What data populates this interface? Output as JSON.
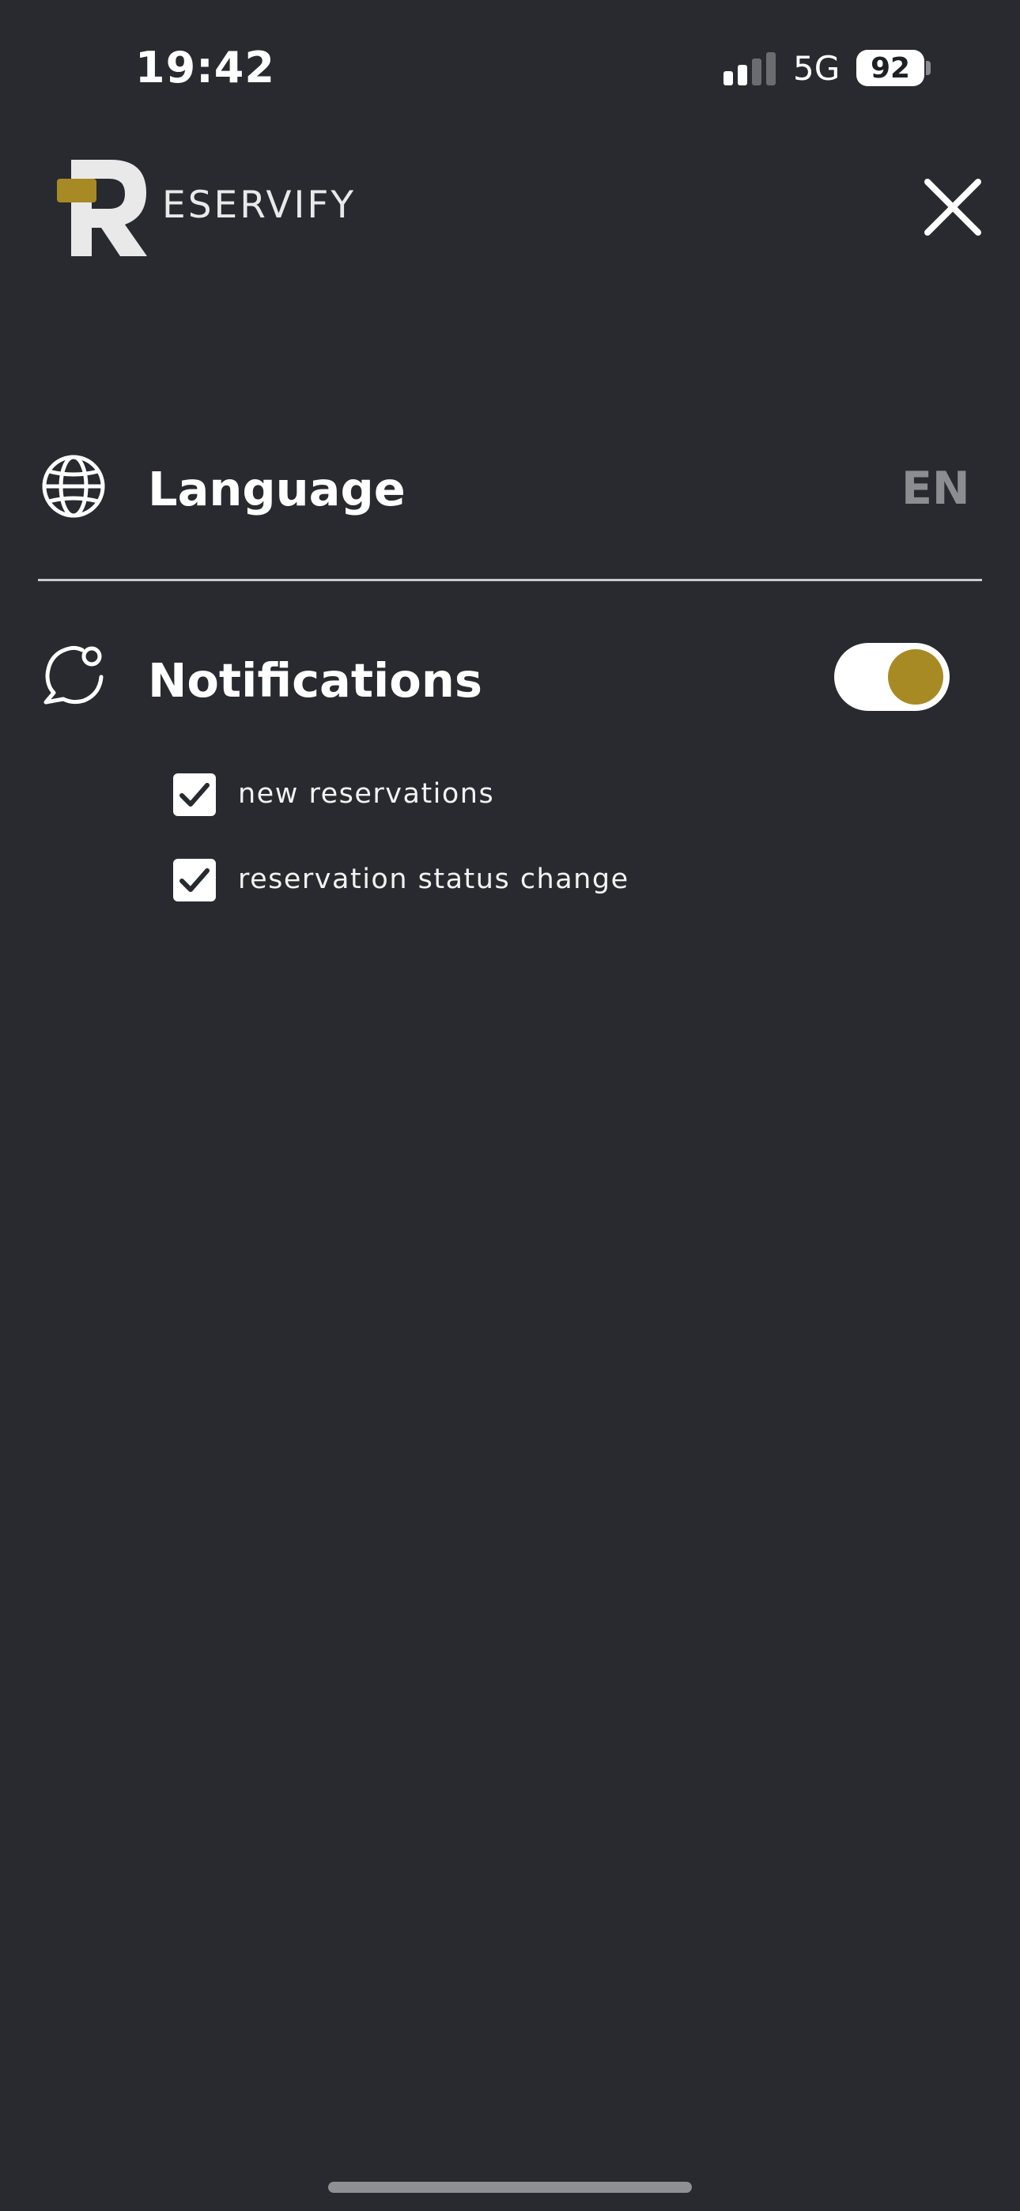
{
  "status_bar": {
    "time": "19:42",
    "network": "5G",
    "battery": "92"
  },
  "header": {
    "brand_text": "ESERVIFY"
  },
  "settings": {
    "language": {
      "label": "Language",
      "value": "EN"
    },
    "notifications": {
      "label": "Notifications",
      "enabled": true,
      "options": [
        {
          "label": "new reservations",
          "checked": true
        },
        {
          "label": "reservation status change",
          "checked": true
        }
      ]
    }
  },
  "colors": {
    "background": "#282a2f",
    "accent": "#a88a24",
    "muted_text": "#8b8d91"
  },
  "icons": {
    "language": "globe-icon",
    "notifications": "chat-bubble-notification-icon",
    "close": "close-icon"
  }
}
